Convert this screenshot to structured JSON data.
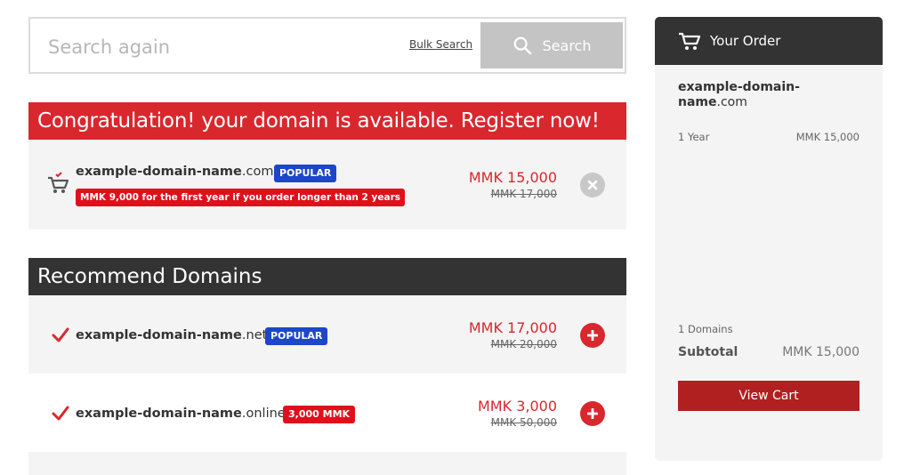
{
  "search": {
    "placeholder": "Search again",
    "bulk_link": "Bulk Search",
    "button_label": "Search"
  },
  "banner": {
    "text": "Congratulation! your domain is available. Register now!"
  },
  "selected_domain": {
    "name": "example-domain-name",
    "tld": ".com",
    "badge": "POPULAR",
    "promo": "MMK 9,000 for the first year if you order longer than 2 years",
    "price_now": "MMK 15,000",
    "price_old": "MMK 17,000"
  },
  "recommend": {
    "title": "Recommend Domains",
    "items": [
      {
        "name": "example-domain-name",
        "tld": ".net",
        "badge": "POPULAR",
        "badge_color": "#1d46c9",
        "price_now": "MMK 17,000",
        "price_old": "MMK 20,000"
      },
      {
        "name": "example-domain-name",
        "tld": ".online",
        "badge": "3,000 MMK",
        "badge_color": "#e0101b",
        "price_now": "MMK 3,000",
        "price_old": "MMK 50,000"
      }
    ]
  },
  "order": {
    "title": "Your Order",
    "domain_name": "example-domain-name",
    "domain_tld": ".com",
    "period": "1 Year",
    "period_price": "MMK 15,000",
    "domain_count": "1 Domains",
    "subtotal_label": "Subtotal",
    "subtotal_value": "MMK 15,000",
    "view_cart_label": "View Cart"
  },
  "colors": {
    "accent_red": "#d9272e",
    "dark_header": "#333333",
    "popular_blue": "#1d46c9",
    "panel_bg": "#f4f4f4"
  }
}
